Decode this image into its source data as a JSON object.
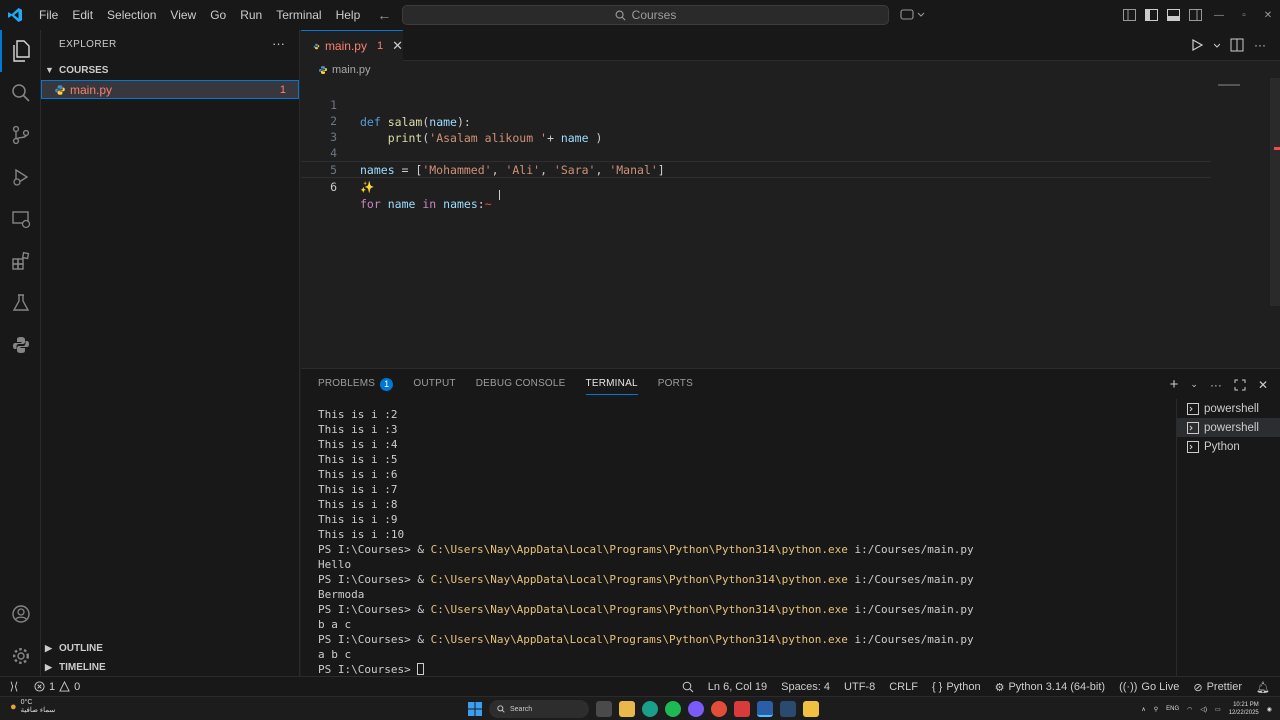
{
  "menu": [
    "File",
    "Edit",
    "Selection",
    "View",
    "Go",
    "Run",
    "Terminal",
    "Help"
  ],
  "search": {
    "text": "Courses"
  },
  "sidebar": {
    "title": "EXPLORER",
    "folder": "COURSES",
    "files": [
      {
        "name": "main.py",
        "problems": "1"
      }
    ],
    "outline": "OUTLINE",
    "timeline": "TIMELINE"
  },
  "tab": {
    "label": "main.py",
    "problems": "1"
  },
  "breadcrumb": "main.py",
  "code": [
    {
      "ln": "1",
      "text": "def salam(name):"
    },
    {
      "ln": "2",
      "text": "    print('Asalam alikoum '+ name )"
    },
    {
      "ln": "3",
      "text": ""
    },
    {
      "ln": "4",
      "text": "names = ['Mohammed', 'Ali', 'Sara', 'Manal']"
    },
    {
      "ln": "5",
      "text": ""
    },
    {
      "ln": "6",
      "text": "for name in names:"
    }
  ],
  "panel": {
    "tabs": [
      "PROBLEMS",
      "OUTPUT",
      "DEBUG CONSOLE",
      "TERMINAL",
      "PORTS"
    ],
    "problems_count": "1",
    "active_tab": "TERMINAL",
    "terminals": [
      "powershell",
      "powershell",
      "Python"
    ]
  },
  "terminal": {
    "prompt": "PS I:\\Courses> & ",
    "command": "C:\\Users\\Nay\\AppData\\Local\\Programs\\Python\\Python314\\python.exe",
    "args": " i:/Courses/main.py",
    "last_prompt": "PS I:\\Courses> ",
    "lines": [
      {
        "type": "out",
        "text": "This is i :2"
      },
      {
        "type": "out",
        "text": "This is i :3"
      },
      {
        "type": "out",
        "text": "This is i :4"
      },
      {
        "type": "out",
        "text": "This is i :5"
      },
      {
        "type": "out",
        "text": "This is i :6"
      },
      {
        "type": "out",
        "text": "This is i :7"
      },
      {
        "type": "out",
        "text": "This is i :8"
      },
      {
        "type": "out",
        "text": "This is i :9"
      },
      {
        "type": "out",
        "text": "This is i :10"
      },
      {
        "type": "cmd"
      },
      {
        "type": "out",
        "text": "Hello"
      },
      {
        "type": "cmd"
      },
      {
        "type": "out",
        "text": "Bermoda"
      },
      {
        "type": "cmd"
      },
      {
        "type": "out",
        "text": "b a c"
      },
      {
        "type": "cmd"
      },
      {
        "type": "out",
        "text": "a b c"
      }
    ]
  },
  "status": {
    "errors": "1",
    "warnings": "0",
    "position": "Ln 6, Col 19",
    "spaces": "Spaces: 4",
    "encoding": "UTF-8",
    "eol": "CRLF",
    "language": "Python",
    "interpreter": "Python 3.14 (64-bit)",
    "golive": "Go Live",
    "prettier": "Prettier"
  },
  "taskbar": {
    "weather_temp": "0°C",
    "weather_text": "سماء صافية",
    "search": "Search",
    "lang": "ENG",
    "time": "10:21 PM",
    "date": "12/22/2025"
  },
  "colors": {
    "accent": "#0078d4",
    "error": "#f88070",
    "command": "#e5c07b"
  }
}
